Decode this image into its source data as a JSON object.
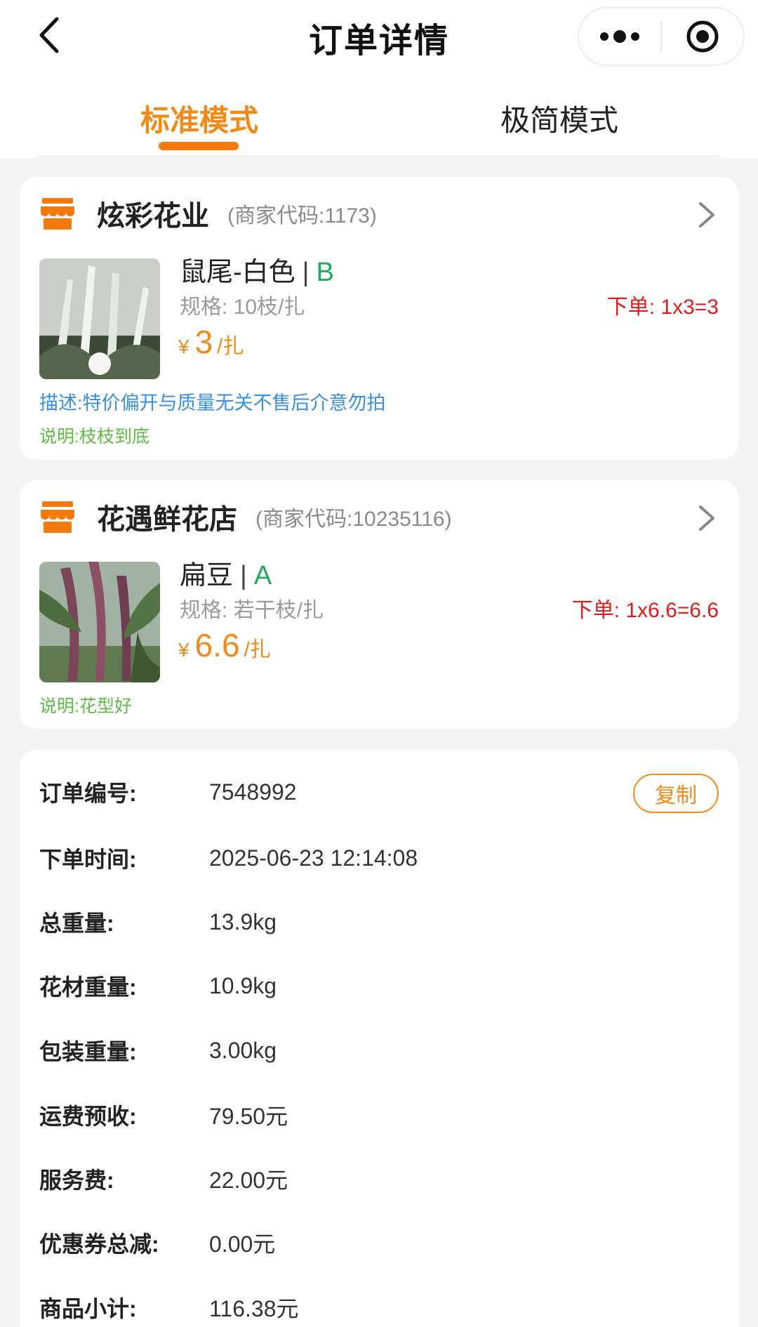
{
  "header": {
    "title": "订单详情",
    "back_icon": "chevron-left-icon",
    "more_icon": "more-dots-icon",
    "close_icon": "target-circle-icon"
  },
  "tabs": [
    {
      "label": "标准模式",
      "active": true
    },
    {
      "label": "极简模式",
      "active": false
    }
  ],
  "colors": {
    "accent": "#f08a19",
    "grade_green": "#22a85e",
    "order_red": "#d81e1e",
    "desc_blue": "#3a8fdc",
    "note_green": "#5fb944"
  },
  "shops": [
    {
      "name": "炫彩花业",
      "code": "(商家代码:1173)",
      "product": {
        "name": "鼠尾-白色",
        "grade": "B",
        "spec": "规格: 10枝/扎",
        "order": "下单: 1x3=3",
        "currency": "¥",
        "price": "3",
        "unit": "/扎",
        "description": "描述:特价偏开与质量无关不售后介意勿拍",
        "note": "说明:枝枝到底"
      }
    },
    {
      "name": "花遇鲜花店",
      "code": "(商家代码:10235116)",
      "product": {
        "name": "扁豆",
        "grade": "A",
        "spec": "规格: 若干枝/扎",
        "order": "下单: 1x6.6=6.6",
        "currency": "¥",
        "price": "6.6",
        "unit": "/扎",
        "note": "说明:花型好"
      }
    }
  ],
  "order_info": {
    "copy_label": "复制",
    "rows": [
      {
        "label": "订单编号:",
        "value": "7548992"
      },
      {
        "label": "下单时间:",
        "value": "2025-06-23 12:14:08"
      },
      {
        "label": "总重量:",
        "value": "13.9kg"
      },
      {
        "label": "花材重量:",
        "value": "10.9kg"
      },
      {
        "label": "包装重量:",
        "value": "3.00kg"
      },
      {
        "label": "运费预收:",
        "value": "79.50元"
      },
      {
        "label": "服务费:",
        "value": "22.00元"
      },
      {
        "label": "优惠券总减:",
        "value": "0.00元"
      },
      {
        "label": "商品小计:",
        "value": "116.38元"
      }
    ]
  }
}
